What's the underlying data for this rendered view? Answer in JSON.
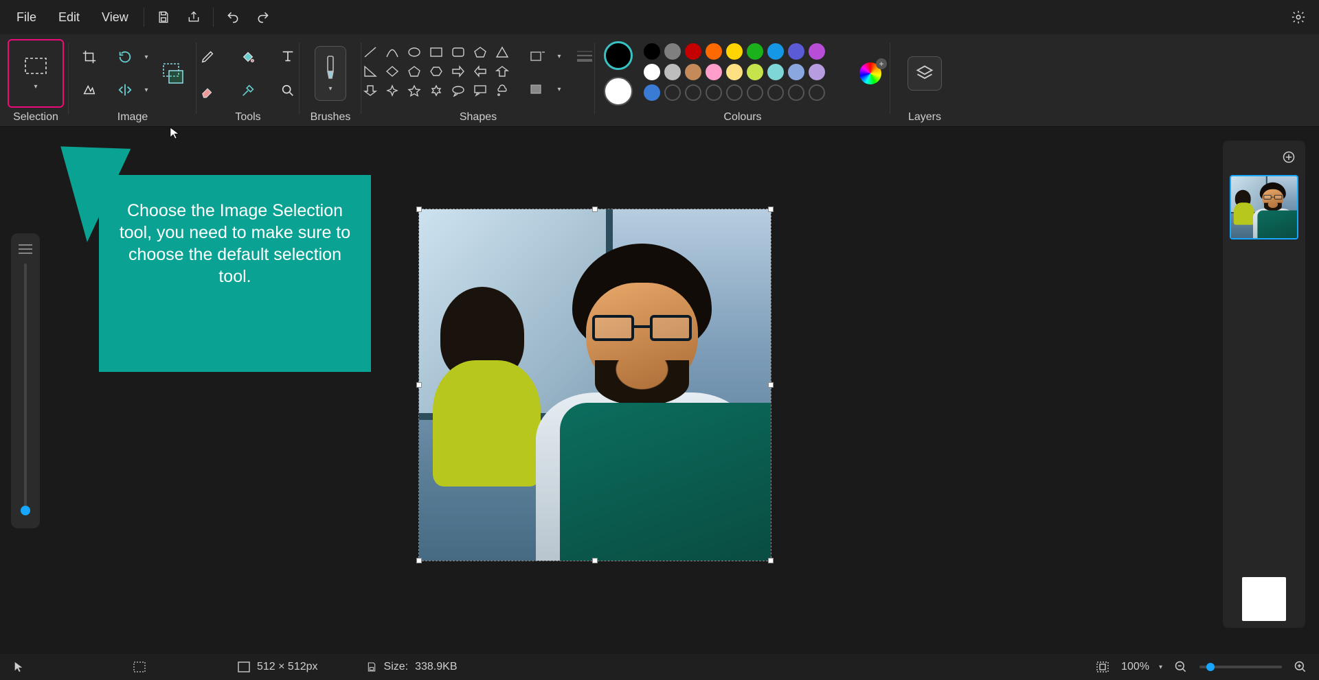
{
  "menu": {
    "file": "File",
    "edit": "Edit",
    "view": "View"
  },
  "ribbon": {
    "selection_label": "Selection",
    "image_label": "Image",
    "tools_label": "Tools",
    "brushes_label": "Brushes",
    "shapes_label": "Shapes",
    "colours_label": "Colours",
    "layers_label": "Layers"
  },
  "callout": {
    "text": "Choose the Image Selection tool, you need to make sure to choose the default selection tool."
  },
  "palette": {
    "row1": [
      "#000000",
      "#7f7f7f",
      "#c40000",
      "#ff6a00",
      "#ffd400",
      "#1bb11b",
      "#1597e5",
      "#5b5bd6",
      "#b84ed8"
    ],
    "row2": [
      "#ffffff",
      "#bdbdbd",
      "#c48a5a",
      "#ff9ecb",
      "#ffe082",
      "#c6e34b",
      "#7ed6d6",
      "#8aa7e0",
      "#b79de0"
    ],
    "row3_filled": "#3a7bd5"
  },
  "status": {
    "dimensions": "512 × 512px",
    "size_label": "Size:",
    "size_value": "338.9KB",
    "zoom": "100%"
  }
}
